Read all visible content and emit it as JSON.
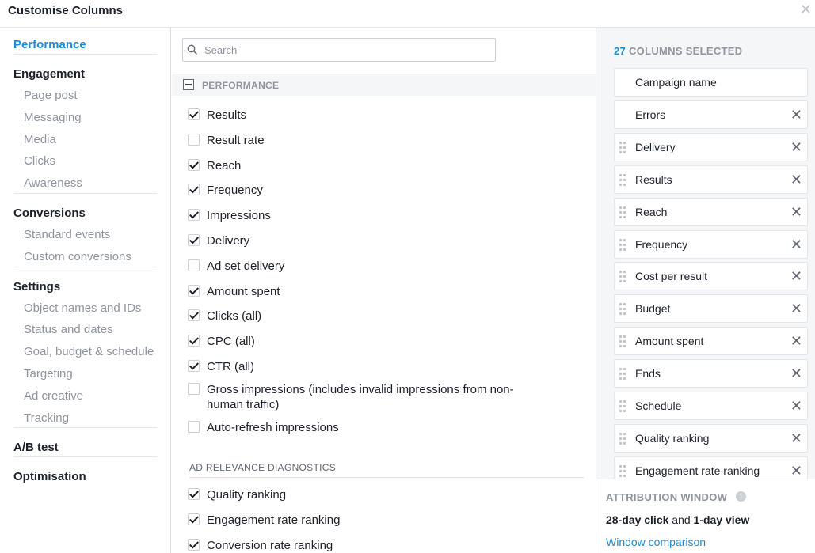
{
  "dialog": {
    "title": "Customise Columns",
    "close_glyph": "✕"
  },
  "nav": {
    "groups": [
      {
        "label": "Performance",
        "active": true,
        "items": []
      },
      {
        "label": "Engagement",
        "active": false,
        "items": [
          "Page post",
          "Messaging",
          "Media",
          "Clicks",
          "Awareness"
        ]
      },
      {
        "label": "Conversions",
        "active": false,
        "items": [
          "Standard events",
          "Custom conversions"
        ]
      },
      {
        "label": "Settings",
        "active": false,
        "items": [
          "Object names and IDs",
          "Status and dates",
          "Goal, budget & schedule",
          "Targeting",
          "Ad creative",
          "Tracking"
        ]
      },
      {
        "label": "A/B test",
        "active": false,
        "items": []
      },
      {
        "label": "Optimisation",
        "active": false,
        "items": []
      }
    ]
  },
  "search": {
    "placeholder": "Search",
    "value": ""
  },
  "section": {
    "title": "PERFORMANCE",
    "options": [
      {
        "label": "Results",
        "checked": true
      },
      {
        "label": "Result rate",
        "checked": false
      },
      {
        "label": "Reach",
        "checked": true
      },
      {
        "label": "Frequency",
        "checked": true
      },
      {
        "label": "Impressions",
        "checked": true
      },
      {
        "label": "Delivery",
        "checked": true
      },
      {
        "label": "Ad set delivery",
        "checked": false
      },
      {
        "label": "Amount spent",
        "checked": true
      },
      {
        "label": "Clicks (all)",
        "checked": true
      },
      {
        "label": "CPC (all)",
        "checked": true
      },
      {
        "label": "CTR (all)",
        "checked": true
      },
      {
        "label": "Gross impressions (includes invalid impressions from non-human traffic)",
        "checked": false
      },
      {
        "label": "Auto-refresh impressions",
        "checked": false
      }
    ]
  },
  "subsection": {
    "title": "AD RELEVANCE DIAGNOSTICS",
    "options": [
      {
        "label": "Quality ranking",
        "checked": true
      },
      {
        "label": "Engagement rate ranking",
        "checked": true
      },
      {
        "label": "Conversion rate ranking",
        "checked": true
      }
    ]
  },
  "selected": {
    "count": "27",
    "count_label": "COLUMNS SELECTED",
    "remove_glyph": "✕",
    "columns": [
      {
        "label": "Campaign name",
        "draggable": false,
        "removable": false
      },
      {
        "label": "Errors",
        "draggable": false,
        "removable": true
      },
      {
        "label": "Delivery",
        "draggable": true,
        "removable": true
      },
      {
        "label": "Results",
        "draggable": true,
        "removable": true
      },
      {
        "label": "Reach",
        "draggable": true,
        "removable": true
      },
      {
        "label": "Frequency",
        "draggable": true,
        "removable": true
      },
      {
        "label": "Cost per result",
        "draggable": true,
        "removable": true
      },
      {
        "label": "Budget",
        "draggable": true,
        "removable": true
      },
      {
        "label": "Amount spent",
        "draggable": true,
        "removable": true
      },
      {
        "label": "Ends",
        "draggable": true,
        "removable": true
      },
      {
        "label": "Schedule",
        "draggable": true,
        "removable": true
      },
      {
        "label": "Quality ranking",
        "draggable": true,
        "removable": true
      },
      {
        "label": "Engagement rate ranking",
        "draggable": true,
        "removable": true
      }
    ]
  },
  "attribution": {
    "title": "ATTRIBUTION WINDOW",
    "info_glyph": "i",
    "click_window": "28-day click",
    "joiner": "and",
    "view_window": "1-day view",
    "link": "Window comparison"
  },
  "colors": {
    "accent": "#1a8cd8",
    "muted": "#90949c",
    "text": "#1d2129"
  }
}
